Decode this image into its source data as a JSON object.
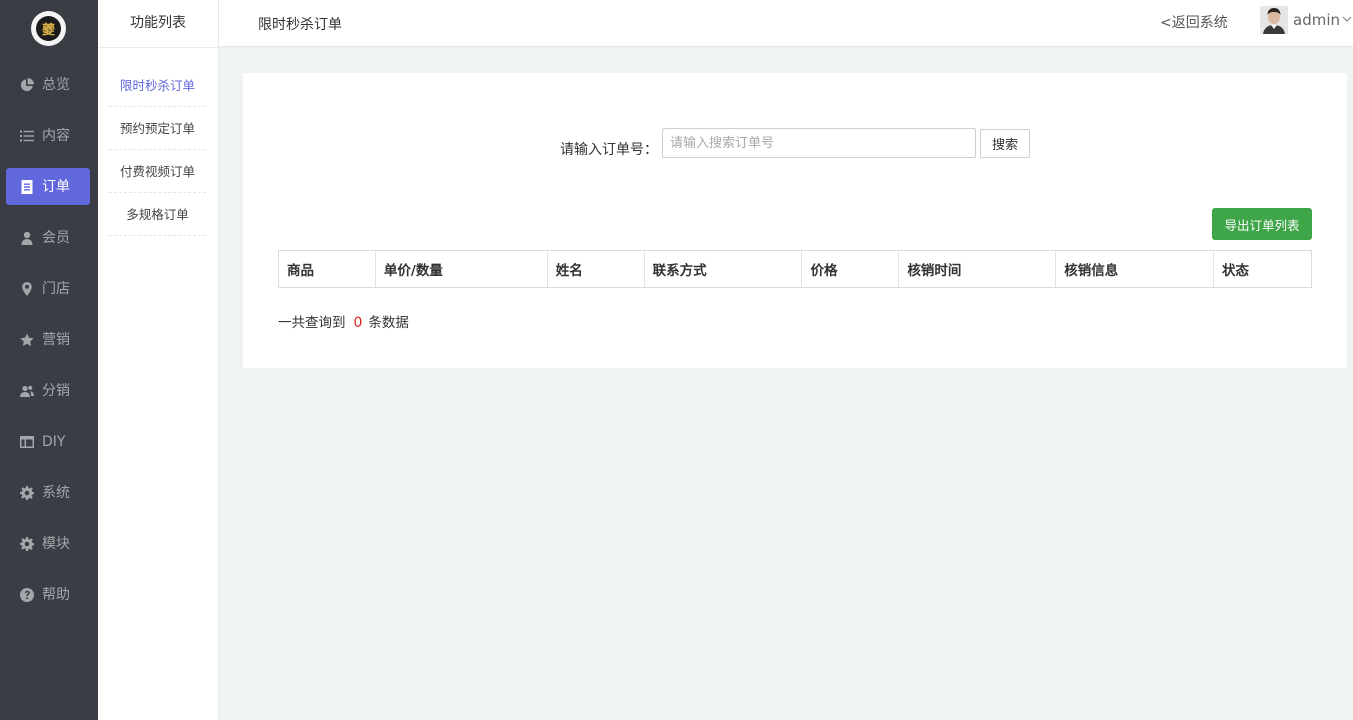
{
  "sidebar": {
    "logo_text": "夔",
    "items": [
      {
        "label": "总览",
        "icon": "pie-chart-icon",
        "active": false
      },
      {
        "label": "内容",
        "icon": "list-icon",
        "active": false
      },
      {
        "label": "订单",
        "icon": "document-icon",
        "active": true
      },
      {
        "label": "会员",
        "icon": "user-icon",
        "active": false
      },
      {
        "label": "门店",
        "icon": "map-pin-icon",
        "active": false
      },
      {
        "label": "营销",
        "icon": "star-icon",
        "active": false
      },
      {
        "label": "分销",
        "icon": "users-icon",
        "active": false
      },
      {
        "label": "DIY",
        "icon": "layout-icon",
        "active": false
      },
      {
        "label": "系统",
        "icon": "gear-icon",
        "active": false
      },
      {
        "label": "模块",
        "icon": "gear-icon",
        "active": false
      },
      {
        "label": "帮助",
        "icon": "help-icon",
        "active": false
      }
    ],
    "accent_color": "#6167dd",
    "background_color": "#3a3d44"
  },
  "subnav": {
    "header": "功能列表",
    "items": [
      {
        "label": "限时秒杀订单",
        "active": true
      },
      {
        "label": "预约预定订单",
        "active": false
      },
      {
        "label": "付费视频订单",
        "active": false
      },
      {
        "label": "多规格订单",
        "active": false
      }
    ]
  },
  "topbar": {
    "title": "限时秒杀订单",
    "back_link": "<返回系统",
    "user_name": "admin"
  },
  "main": {
    "search": {
      "label": "请输入订单号：",
      "placeholder": "请输入搜索订单号",
      "value": "",
      "button_label": "搜索"
    },
    "export_button_label": "导出订单列表",
    "export_button_color": "#3ea648",
    "table": {
      "columns": [
        "商品",
        "单价/数量",
        "姓名",
        "联系方式",
        "价格",
        "核销时间",
        "核销信息",
        "状态"
      ],
      "rows": []
    },
    "result": {
      "prefix": "一共查询到",
      "count": "0",
      "suffix": "条数据"
    }
  }
}
